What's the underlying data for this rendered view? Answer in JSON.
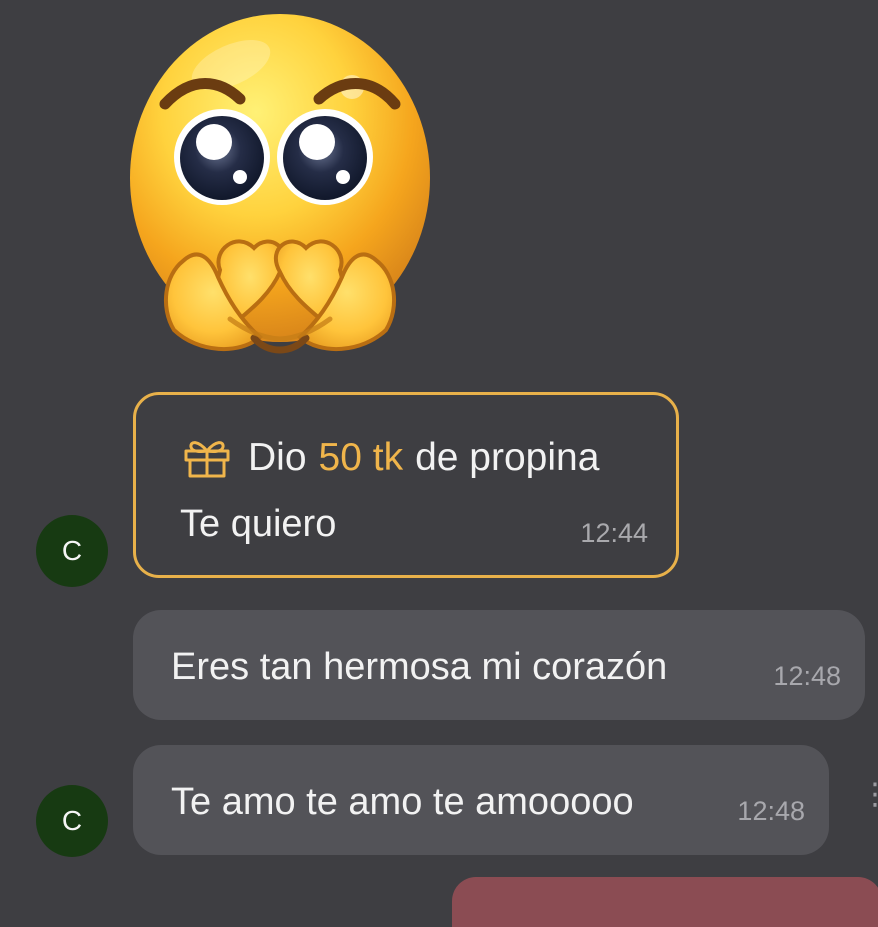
{
  "colors": {
    "background": "#3e3e42",
    "bubble": "#535358",
    "tip_border": "#e8b14a",
    "tip_amount": "#f0b54b",
    "avatar": "#173a12",
    "timestamp": "#a8a8ad",
    "outgoing_peek": "#8b4c53"
  },
  "sticker": {
    "icon": "pleading-face-heart-hands-emoji"
  },
  "avatar_initial": "C",
  "tip": {
    "icon": "gift-icon",
    "prefix": "Dio",
    "amount": "50 tk",
    "suffix": "de propina",
    "message": "Te quiero",
    "time": "12:44"
  },
  "messages": [
    {
      "text": "Eres tan hermosa mi corazón",
      "time": "12:48"
    },
    {
      "text": "Te amo te amo te amooooo",
      "time": "12:48"
    }
  ]
}
